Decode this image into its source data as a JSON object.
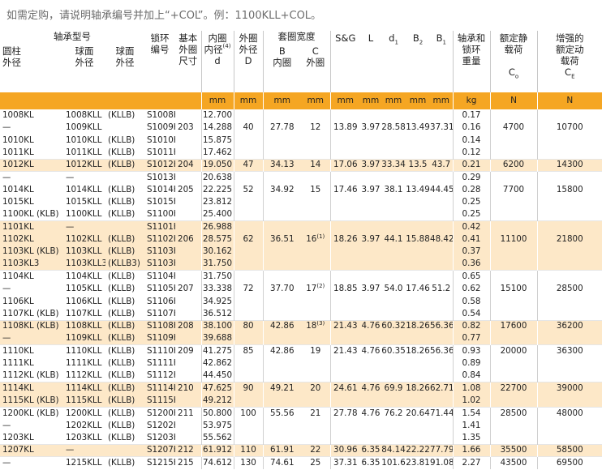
{
  "note": "如需定购，请说明轴承编号并加上“+COL”。例：1100KLL+COL。",
  "header": {
    "bearing_no": "轴承型号",
    "cylinder": "圆柱\n外径",
    "sphere1": "球面\n外径",
    "sphere2": "球面\n外径",
    "collar_no": "锁环\n编号",
    "basic_size": "基本\n外圈\n尺寸",
    "bore": "内圈\n内径",
    "bore_sup": "(4)",
    "bore_sym": "d",
    "od": "外圈\n外径",
    "od_sym": "D",
    "ring_width": "套圈宽度",
    "inner_sym": "B",
    "inner": "内圈",
    "outer_sym": "C",
    "outer": "外圈",
    "sg": "S&G",
    "L": "L",
    "d1": "d",
    "d1_sub": "1",
    "B2": "B",
    "B2_sub": "2",
    "B1": "B",
    "B1_sub": "1",
    "weight": "轴承和\n锁环\n重量",
    "static": "额定静\n载荷",
    "static_sym": "C",
    "static_sub": "o",
    "dynamic": "增强的\n额定动\n载荷",
    "dynamic_sym": "C",
    "dynamic_sub": "E"
  },
  "units": [
    "mm",
    "mm",
    "mm",
    "mm",
    "mm",
    "mm",
    "mm",
    "mm",
    "mm",
    "mm",
    "kg",
    "N",
    "N"
  ],
  "rows": [
    {
      "g": 0,
      "cyl": "1008KL",
      "sph": "1008KLL",
      "alt": "(KLLB)",
      "col": "S1008K",
      "bs": "",
      "d": "12.700",
      "D": "",
      "B": "",
      "C": "",
      "sg": "",
      "L": "",
      "d1": "",
      "B2": "",
      "B1": "",
      "w": "0.17",
      "co": "",
      "ce": ""
    },
    {
      "g": 0,
      "cyl": "—",
      "sph": "1009KLL",
      "alt": "",
      "col": "S1009K",
      "bs": "203",
      "d": "14.288",
      "D": "40",
      "B": "27.78",
      "C": "12",
      "sg": "13.89",
      "L": "3.97",
      "d1": "28.58",
      "B2": "13.49",
      "B1": "37.31",
      "w": "0.16",
      "co": "4700",
      "ce": "10700"
    },
    {
      "g": 0,
      "cyl": "1010KL",
      "sph": "1010KLL",
      "alt": "(KLLB)",
      "col": "S1010K",
      "bs": "",
      "d": "15.875",
      "D": "",
      "B": "",
      "C": "",
      "sg": "",
      "L": "",
      "d1": "",
      "B2": "",
      "B1": "",
      "w": "0.14",
      "co": "",
      "ce": ""
    },
    {
      "g": 0,
      "cyl": "1011KL",
      "sph": "1011KLL",
      "alt": "(KLLB)",
      "col": "S1011K",
      "bs": "",
      "d": "17.462",
      "D": "",
      "B": "",
      "C": "",
      "sg": "",
      "L": "",
      "d1": "",
      "B2": "",
      "B1": "",
      "w": "0.12",
      "co": "",
      "ce": ""
    },
    {
      "g": 1,
      "cyl": "1012KL",
      "sph": "1012KLL",
      "alt": "(KLLB)",
      "col": "S1012K",
      "bs": "204",
      "d": "19.050",
      "D": "47",
      "B": "34.13",
      "C": "14",
      "sg": "17.06",
      "L": "3.97",
      "d1": "33.34",
      "B2": "13.5",
      "B1": "43.7",
      "w": "0.21",
      "co": "6200",
      "ce": "14300"
    },
    {
      "g": 2,
      "cyl": "—",
      "sph": "—",
      "alt": "",
      "col": "S1013K",
      "bs": "",
      "d": "20.638",
      "D": "",
      "B": "",
      "C": "",
      "sg": "",
      "L": "",
      "d1": "",
      "B2": "",
      "B1": "",
      "w": "0.29",
      "co": "",
      "ce": ""
    },
    {
      "g": 2,
      "cyl": "1014KL",
      "sph": "1014KLL",
      "alt": "(KLLB)",
      "col": "S1014K",
      "bs": "205",
      "d": "22.225",
      "D": "52",
      "B": "34.92",
      "C": "15",
      "sg": "17.46",
      "L": "3.97",
      "d1": "38.1",
      "B2": "13.49",
      "B1": "44.45",
      "w": "0.28",
      "co": "7700",
      "ce": "15800"
    },
    {
      "g": 2,
      "cyl": "1015KL",
      "sph": "1015KLL",
      "alt": "(KLLB)",
      "col": "S1015K",
      "bs": "",
      "d": "23.812",
      "D": "",
      "B": "",
      "C": "",
      "sg": "",
      "L": "",
      "d1": "",
      "B2": "",
      "B1": "",
      "w": "0.25",
      "co": "",
      "ce": ""
    },
    {
      "g": 2,
      "cyl": "1100KL (KLB)",
      "sph": "1100KLL",
      "alt": "(KLLB)",
      "col": "S1100K",
      "bs": "",
      "d": "25.400",
      "D": "",
      "B": "",
      "C": "",
      "sg": "",
      "L": "",
      "d1": "",
      "B2": "",
      "B1": "",
      "w": "0.25",
      "co": "",
      "ce": ""
    },
    {
      "g": 3,
      "cyl": "1101KL",
      "sph": "—",
      "alt": "",
      "col": "S1101K",
      "bs": "",
      "d": "26.988",
      "D": "",
      "B": "",
      "C": "",
      "sg": "",
      "L": "",
      "d1": "",
      "B2": "",
      "B1": "",
      "w": "0.42",
      "co": "",
      "ce": ""
    },
    {
      "g": 3,
      "cyl": "1102KL",
      "sph": "1102KLL",
      "alt": "(KLLB)",
      "col": "S1102K",
      "bs": "206",
      "d": "28.575",
      "D": "62",
      "B": "36.51",
      "C": "16",
      "Csup": "(1)",
      "sg": "18.26",
      "L": "3.97",
      "d1": "44.1",
      "B2": "15.88",
      "B1": "48.42",
      "w": "0.41",
      "co": "11100",
      "ce": "21800"
    },
    {
      "g": 3,
      "cyl": "1103KL (KLB)",
      "sph": "1103KLL",
      "alt": "(KLLB)",
      "col": "S1103K",
      "bs": "",
      "d": "30.162",
      "D": "",
      "B": "",
      "C": "",
      "sg": "",
      "L": "",
      "d1": "",
      "B2": "",
      "B1": "",
      "w": "0.37",
      "co": "",
      "ce": ""
    },
    {
      "g": 3,
      "cyl": "1103KL3",
      "sph": "1103KLL3",
      "alt": "(KLLB3)",
      "col": "S1103K3",
      "bs": "",
      "d": "31.750",
      "D": "",
      "B": "",
      "C": "",
      "sg": "",
      "L": "",
      "d1": "",
      "B2": "",
      "B1": "",
      "w": "0.36",
      "co": "",
      "ce": ""
    },
    {
      "g": 4,
      "cyl": "1104KL",
      "sph": "1104KLL",
      "alt": "(KLLB)",
      "col": "S1104K",
      "bs": "",
      "d": "31.750",
      "D": "",
      "B": "",
      "C": "",
      "sg": "",
      "L": "",
      "d1": "",
      "B2": "",
      "B1": "",
      "w": "0.65",
      "co": "",
      "ce": ""
    },
    {
      "g": 4,
      "cyl": "—",
      "sph": "1105KLL",
      "alt": "(KLLB)",
      "col": "S1105K",
      "bs": "207",
      "d": "33.338",
      "D": "72",
      "B": "37.70",
      "C": "17",
      "Csup": "(2)",
      "sg": "18.85",
      "L": "3.97",
      "d1": "54.0",
      "B2": "17.46",
      "B1": "51.2",
      "w": "0.62",
      "co": "15100",
      "ce": "28500"
    },
    {
      "g": 4,
      "cyl": "1106KL",
      "sph": "1106KLL",
      "alt": "(KLLB)",
      "col": "S1106K",
      "bs": "",
      "d": "34.925",
      "D": "",
      "B": "",
      "C": "",
      "sg": "",
      "L": "",
      "d1": "",
      "B2": "",
      "B1": "",
      "w": "0.58",
      "co": "",
      "ce": ""
    },
    {
      "g": 4,
      "cyl": "1107KL (KLB)",
      "sph": "1107KLL",
      "alt": "(KLLB)",
      "col": "S1107K",
      "bs": "",
      "d": "36.512",
      "D": "",
      "B": "",
      "C": "",
      "sg": "",
      "L": "",
      "d1": "",
      "B2": "",
      "B1": "",
      "w": "0.54",
      "co": "",
      "ce": ""
    },
    {
      "g": 5,
      "cyl": "1108KL (KLB)",
      "sph": "1108KLL",
      "alt": "(KLLB)",
      "col": "S1108K",
      "bs": "208",
      "d": "38.100",
      "D": "80",
      "B": "42.86",
      "C": "18",
      "Csup": "(3)",
      "sg": "21.43",
      "L": "4.76",
      "d1": "60.32",
      "B2": "18.26",
      "B1": "56.36",
      "w": "0.82",
      "co": "17600",
      "ce": "36200"
    },
    {
      "g": 5,
      "cyl": "—",
      "sph": "1109KLL",
      "alt": "(KLLB)",
      "col": "S1109K",
      "bs": "",
      "d": "39.688",
      "D": "",
      "B": "",
      "C": "",
      "sg": "",
      "L": "",
      "d1": "",
      "B2": "",
      "B1": "",
      "w": "0.77",
      "co": "",
      "ce": ""
    },
    {
      "g": 6,
      "cyl": "1110KL",
      "sph": "1110KLL",
      "alt": "(KLLB)",
      "col": "S1110K",
      "bs": "209",
      "d": "41.275",
      "D": "85",
      "B": "42.86",
      "C": "19",
      "sg": "21.43",
      "L": "4.76",
      "d1": "60.35",
      "B2": "18.26",
      "B1": "56.36",
      "w": "0.93",
      "co": "20000",
      "ce": "36300"
    },
    {
      "g": 6,
      "cyl": "1111KL",
      "sph": "1111KLL",
      "alt": "(KLLB)",
      "col": "S1111K",
      "bs": "",
      "d": "42.862",
      "D": "",
      "B": "",
      "C": "",
      "sg": "",
      "L": "",
      "d1": "",
      "B2": "",
      "B1": "",
      "w": "0.89",
      "co": "",
      "ce": ""
    },
    {
      "g": 6,
      "cyl": "1112KL (KLB)",
      "sph": "1112KLL",
      "alt": "(KLLB)",
      "col": "S1112K",
      "bs": "",
      "d": "44.450",
      "D": "",
      "B": "",
      "C": "",
      "sg": "",
      "L": "",
      "d1": "",
      "B2": "",
      "B1": "",
      "w": "0.84",
      "co": "",
      "ce": ""
    },
    {
      "g": 7,
      "cyl": "1114KL",
      "sph": "1114KLL",
      "alt": "(KLLB)",
      "col": "S1114K",
      "bs": "210",
      "d": "47.625",
      "D": "90",
      "B": "49.21",
      "C": "20",
      "sg": "24.61",
      "L": "4.76",
      "d1": "69.9",
      "B2": "18.26",
      "B1": "62.71",
      "w": "1.08",
      "co": "22700",
      "ce": "39000"
    },
    {
      "g": 7,
      "cyl": "1115KL (KLB)",
      "sph": "1115KLL",
      "alt": "(KLLB)",
      "col": "S1115K",
      "bs": "",
      "d": "49.212",
      "D": "",
      "B": "",
      "C": "",
      "sg": "",
      "L": "",
      "d1": "",
      "B2": "",
      "B1": "",
      "w": "1.02",
      "co": "",
      "ce": ""
    },
    {
      "g": 8,
      "cyl": "1200KL (KLB)",
      "sph": "1200KLL",
      "alt": "(KLLB)",
      "col": "S1200K",
      "bs": "211",
      "d": "50.800",
      "D": "100",
      "B": "55.56",
      "C": "21",
      "sg": "27.78",
      "L": "4.76",
      "d1": "76.2",
      "B2": "20.64",
      "B1": "71.44",
      "w": "1.54",
      "co": "28500",
      "ce": "48000"
    },
    {
      "g": 8,
      "cyl": "—",
      "sph": "1202KLL",
      "alt": "(KLLB)",
      "col": "S1202K",
      "bs": "",
      "d": "53.975",
      "D": "",
      "B": "",
      "C": "",
      "sg": "",
      "L": "",
      "d1": "",
      "B2": "",
      "B1": "",
      "w": "1.41",
      "co": "",
      "ce": ""
    },
    {
      "g": 8,
      "cyl": "1203KL",
      "sph": "1203KLL",
      "alt": "(KLLB)",
      "col": "S1203K",
      "bs": "",
      "d": "55.562",
      "D": "",
      "B": "",
      "C": "",
      "sg": "",
      "L": "",
      "d1": "",
      "B2": "",
      "B1": "",
      "w": "1.35",
      "co": "",
      "ce": ""
    },
    {
      "g": 9,
      "cyl": "1207KL",
      "sph": "—",
      "alt": "",
      "col": "S1207K",
      "bs": "212",
      "d": "61.912",
      "D": "110",
      "B": "61.91",
      "C": "22",
      "sg": "30.96",
      "L": "6.35",
      "d1": "84.14",
      "B2": "22.22",
      "B1": "77.79",
      "w": "1.66",
      "co": "35500",
      "ce": "58500"
    },
    {
      "g": 10,
      "cyl": "—",
      "sph": "1215KLL",
      "alt": "(KLLB)",
      "col": "S1215K",
      "bs": "215",
      "d": "74.612",
      "D": "130",
      "B": "74.61",
      "C": "25",
      "sg": "37.31",
      "L": "6.35",
      "d1": "101.6",
      "B2": "23.81",
      "B1": "91.08",
      "w": "2.27",
      "co": "43500",
      "ce": "69500"
    }
  ],
  "colors": {
    "accent": "#f5a623",
    "band": "#fde8c8"
  }
}
